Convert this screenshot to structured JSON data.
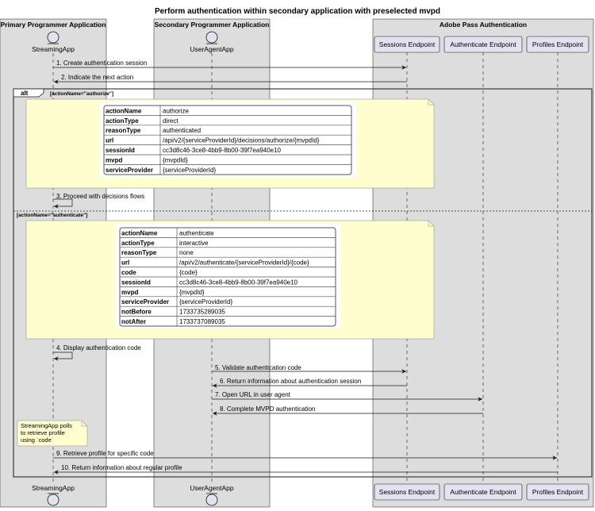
{
  "title": "Perform authentication within secondary application with preselected mvpd",
  "boxes": [
    {
      "label": "Primary Programmer Application"
    },
    {
      "label": "Secondary Programmer Application"
    },
    {
      "label": "Adobe Pass Authentication"
    }
  ],
  "participants": [
    {
      "label": "StreamingApp",
      "type": "entity"
    },
    {
      "label": "UserAgentApp",
      "type": "entity"
    },
    {
      "label": "Sessions Endpoint",
      "type": "participant"
    },
    {
      "label": "Authenticate Endpoint",
      "type": "participant"
    },
    {
      "label": "Profiles Endpoint",
      "type": "participant"
    }
  ],
  "messages": [
    {
      "label": "1. Create authentication session"
    },
    {
      "label": "2. Indicate the next action"
    },
    {
      "label": "3. Proceed with decisions flows"
    },
    {
      "label": "4. Display authentication code"
    },
    {
      "label": "5. Validate authentication code"
    },
    {
      "label": "6. Return information about authentication session"
    },
    {
      "label": "7. Open URL in user agent"
    },
    {
      "label": "8. Complete MVPD authentication"
    },
    {
      "label": "9. Retrieve profile for specific code"
    },
    {
      "label": "10. Return information about regular profile"
    }
  ],
  "alt": {
    "keyword": "alt",
    "guard1": "[actionName=\"authorize\"]",
    "guard2": "[actionName=\"authenticate\"]"
  },
  "note_table_1": [
    [
      "actionName",
      "authorize"
    ],
    [
      "actionType",
      "direct"
    ],
    [
      "reasonType",
      "authenticated"
    ],
    [
      "url",
      "/api/v2/{serviceProviderId}/decisions/authorize/{mvpdId}"
    ],
    [
      "sessionId",
      "cc3d8c46-3ce8-4bb9-8b00-39f7ea940e10"
    ],
    [
      "mvpd",
      "{mvpdId}"
    ],
    [
      "serviceProvider",
      "{serviceProviderId}"
    ]
  ],
  "note_table_2": [
    [
      "actionName",
      "authenticate"
    ],
    [
      "actionType",
      "interactive"
    ],
    [
      "reasonType",
      "none"
    ],
    [
      "url",
      "/api/v2/authenticate/{serviceProviderId}/{code}"
    ],
    [
      "code",
      "{code}"
    ],
    [
      "sessionId",
      "cc3d8c46-3ce8-4bb9-8b00-39f7ea940e10"
    ],
    [
      "mvpd",
      "{mvpdId}"
    ],
    [
      "serviceProvider",
      "{serviceProviderId}"
    ],
    [
      "notBefore",
      "1733735289035"
    ],
    [
      "notAfter",
      "1733737089035"
    ]
  ],
  "side_note": [
    "StreamingApp polls",
    "to retrieve profile",
    "using `code`"
  ],
  "colors": {
    "box_fill": "#dddddd",
    "box_stroke": "#181818",
    "participant_fill": "#e2e2f0",
    "note_fill": "#fefece",
    "note_stroke": "#a8a8a8",
    "line": "#181818"
  }
}
